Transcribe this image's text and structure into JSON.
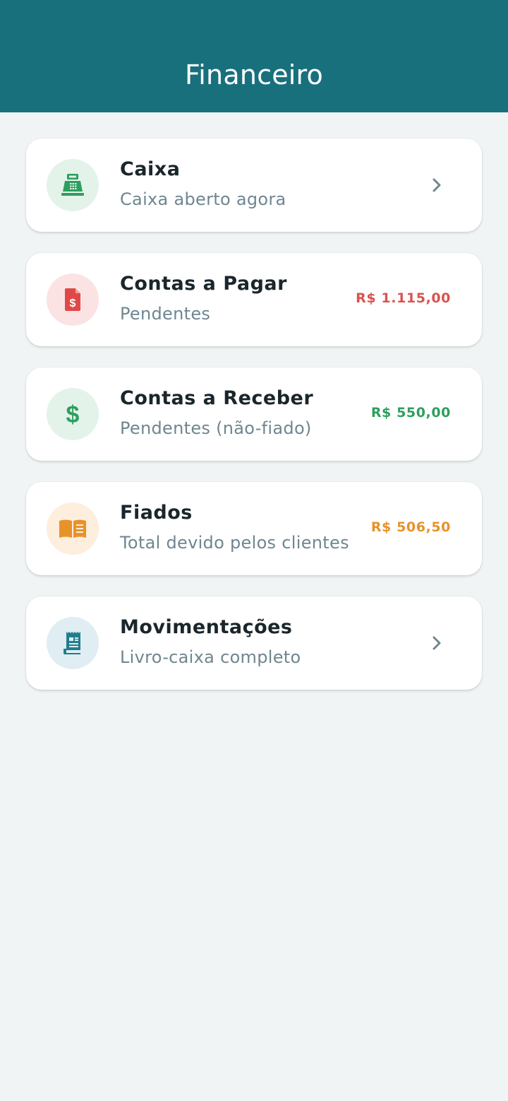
{
  "header": {
    "title": "Financeiro"
  },
  "items": [
    {
      "title": "Caixa",
      "subtitle": "Caixa aberto agora",
      "icon": "cash-register-icon",
      "trailing": "chevron",
      "icon_color": "#2e9e5e",
      "icon_bg": "#e3f3ea"
    },
    {
      "title": "Contas a Pagar",
      "subtitle": "Pendentes",
      "icon": "invoice-dollar-icon",
      "trailing": "amount",
      "amount": "R$ 1.115,00",
      "amount_color": "#d9534f",
      "icon_color": "#e04848",
      "icon_bg": "#fbe3e3"
    },
    {
      "title": "Contas a Receber",
      "subtitle": "Pendentes (não-fiado)",
      "icon": "dollar-sign-icon",
      "trailing": "amount",
      "amount": "R$ 550,00",
      "amount_color": "#2e9e5e",
      "icon_color": "#2e9e5e",
      "icon_bg": "#e3f3ea"
    },
    {
      "title": "Fiados",
      "subtitle": "Total devido pelos clientes",
      "icon": "open-book-icon",
      "trailing": "amount",
      "amount": "R$ 506,50",
      "amount_color": "#e8922a",
      "icon_color": "#e8922a",
      "icon_bg": "#fdeedd"
    },
    {
      "title": "Movimentações",
      "subtitle": "Livro-caixa completo",
      "icon": "receipt-icon",
      "trailing": "chevron",
      "icon_color": "#1f7f8e",
      "icon_bg": "#e0edf2"
    }
  ]
}
